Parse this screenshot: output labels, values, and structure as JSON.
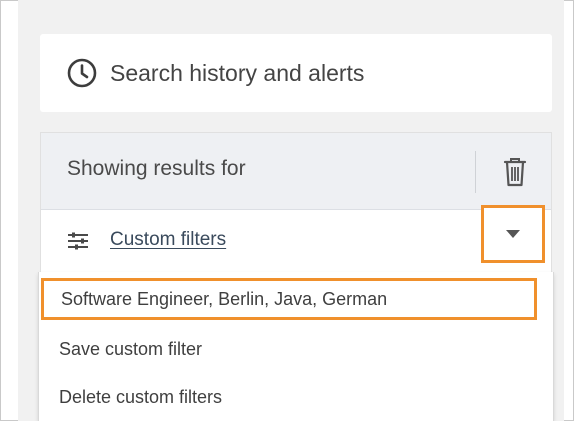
{
  "search_history": {
    "label": "Search history and alerts",
    "icon": "clock-icon"
  },
  "filters": {
    "header_label": "Showing results for",
    "delete_icon": "trash-icon",
    "filter_icon": "sliders-icon",
    "custom_filters_label": "Custom filters",
    "toggle_icon": "chevron-down-icon"
  },
  "dropdown": {
    "items": [
      {
        "label": "Software Engineer, Berlin, Java, German"
      },
      {
        "label": "Save custom filter"
      },
      {
        "label": "Delete custom filters"
      }
    ]
  },
  "colors": {
    "highlight_outline": "#f0902c",
    "panel_background": "#f1f1f1",
    "header_background": "#eef0f3"
  }
}
